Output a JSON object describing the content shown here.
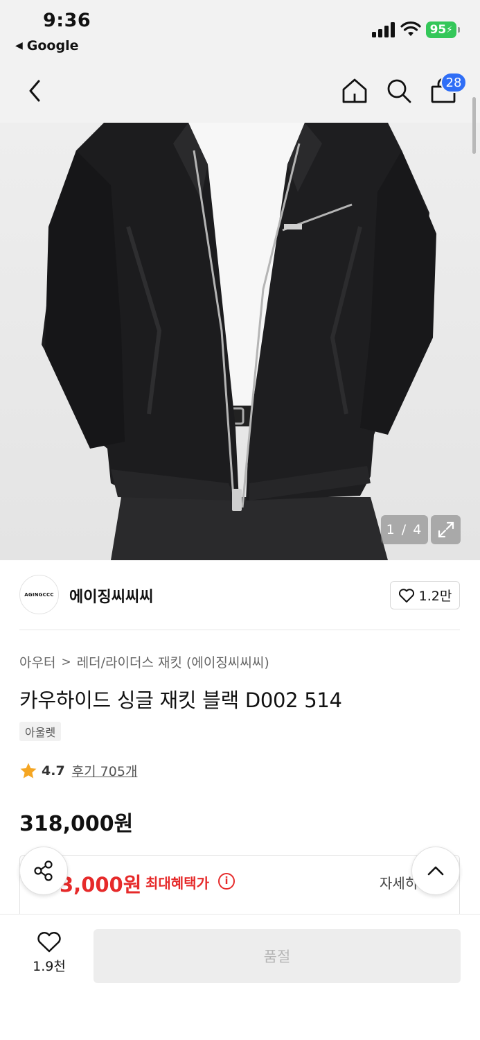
{
  "status_bar": {
    "time": "9:36",
    "back_app": "Google",
    "battery": "95"
  },
  "nav": {
    "cart_badge": "28",
    "icons": [
      "back-chevron-icon",
      "home-icon",
      "search-icon",
      "shopping-bag-icon"
    ]
  },
  "gallery": {
    "counter": "1 / 4"
  },
  "brand": {
    "logo_text": "AGINGCCC",
    "name": "에이징씨씨씨",
    "likes": "1.2만"
  },
  "product": {
    "breadcrumb": [
      "아우터",
      "레더/라이더스 재킷 (에이징씨씨씨)"
    ],
    "title": "카우하이드 싱글 재킷 블랙 D002 514",
    "tag": "아울렛",
    "rating": "4.7",
    "reviews": "후기 705개",
    "price": "318,000원"
  },
  "benefit": {
    "price": "3,000원",
    "label": "최대혜택가",
    "info_icon": "i",
    "detail": "자세히"
  },
  "bottom_bar": {
    "wish_count": "1.9천",
    "buy_button": "품절"
  },
  "colors": {
    "accent_blue": "#2f6ef6",
    "sale_red": "#e62a2a",
    "battery_green": "#34c759"
  }
}
